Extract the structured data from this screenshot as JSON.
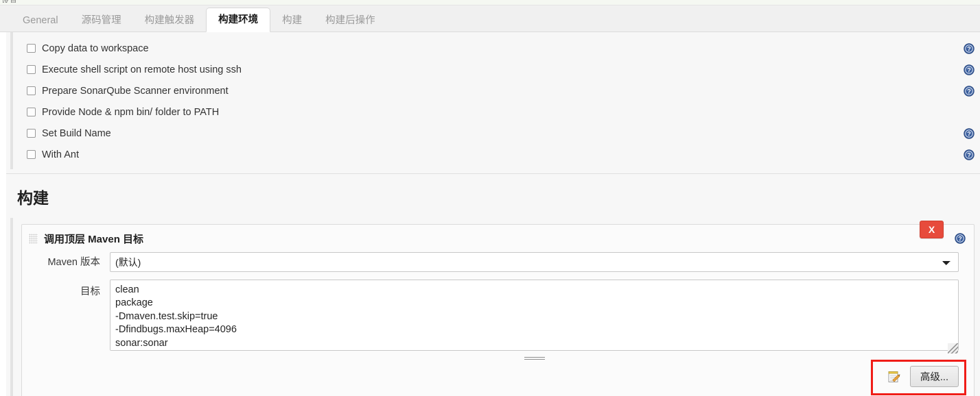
{
  "window": {
    "top_crumb": "设置"
  },
  "tabs": [
    {
      "label": "General",
      "active": false
    },
    {
      "label": "源码管理",
      "active": false
    },
    {
      "label": "构建触发器",
      "active": false
    },
    {
      "label": "构建环境",
      "active": true
    },
    {
      "label": "构建",
      "active": false
    },
    {
      "label": "构建后操作",
      "active": false
    }
  ],
  "build_environment": {
    "options": [
      {
        "label": "Copy data to workspace",
        "checked": false,
        "has_help": true
      },
      {
        "label": "Execute shell script on remote host using ssh",
        "checked": false,
        "has_help": true
      },
      {
        "label": "Prepare SonarQube Scanner environment",
        "checked": false,
        "has_help": true
      },
      {
        "label": "Provide Node & npm bin/ folder to PATH",
        "checked": false,
        "has_help": false
      },
      {
        "label": "Set Build Name",
        "checked": false,
        "has_help": true
      },
      {
        "label": "With Ant",
        "checked": false,
        "has_help": true
      }
    ]
  },
  "build_section": {
    "title": "构建",
    "step": {
      "title": "调用顶层 Maven 目标",
      "delete_label": "X",
      "maven_version": {
        "label": "Maven 版本",
        "value": "(默认)",
        "options": [
          "(默认)"
        ]
      },
      "goals": {
        "label": "目标",
        "value": "clean\npackage\n-Dmaven.test.skip=true\n-Dfindbugs.maxHeap=4096\nsonar:sonar",
        "placeholder": ""
      },
      "advanced_label": "高级..."
    }
  },
  "icons": {
    "help": "help-circle-icon",
    "grip": "drag-handle-icon",
    "notepad": "notepad-edit-icon",
    "chevron": "chevron-down-icon"
  },
  "colors": {
    "accent_blue": "#3b5f9e",
    "danger_red": "#e74b3c",
    "highlight_red": "#f01d18",
    "page_bg": "#f7f7f7",
    "tabbar_bg": "#f0f0f0"
  }
}
